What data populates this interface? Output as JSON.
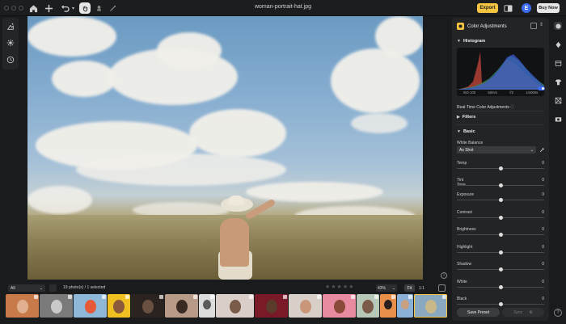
{
  "window": {
    "title": "woman-portrait-hat.jpg"
  },
  "toolbar": {
    "export_label": "Export",
    "avatar_letter": "E",
    "buy_now_label": "Buy Now"
  },
  "panel": {
    "title": "Color Adjustments",
    "histogram": {
      "title": "Histogram",
      "iso": "ISO 100",
      "focal": "50mm",
      "aperture": "f/2",
      "shutter": "1/4000s"
    },
    "realtime_label": "Real-Time Color Adjustments",
    "realtime_on": true,
    "filters_label": "Filters",
    "basic_label": "Basic",
    "white_balance": {
      "label": "White Balance",
      "value": "As Shot"
    },
    "wb_sliders": [
      {
        "label": "Temp",
        "value": "0",
        "level": 0.5
      },
      {
        "label": "Tint",
        "value": "0",
        "level": 0.5
      }
    ],
    "tone_label": "Tone",
    "tone_sliders": [
      {
        "label": "Exposure",
        "value": "0",
        "level": 0.5
      },
      {
        "label": "Contrast",
        "value": "0",
        "level": 0.5
      },
      {
        "label": "Brightness",
        "value": "0",
        "level": 0.5
      },
      {
        "label": "Highlight",
        "value": "0",
        "level": 0.5
      },
      {
        "label": "Shadow",
        "value": "0",
        "level": 0.5
      },
      {
        "label": "White",
        "value": "0",
        "level": 0.5
      },
      {
        "label": "Black",
        "value": "0",
        "level": 0.5
      }
    ],
    "save_preset_label": "Save Preset",
    "sync_label": "Sync"
  },
  "filmstrip": {
    "filter_value": "All",
    "count_text": "19 photo(s) / 1 selected",
    "stars": "★★★★★",
    "zoom_value": "43%",
    "fit_label": "Fit",
    "one_label": "1:1",
    "thumbnails": [
      {
        "name": "group-selfie",
        "bg": "#c97a4a",
        "head": "#e0b090",
        "selected": false,
        "width": 41
      },
      {
        "name": "man-with-cat",
        "bg": "#7a7a7a",
        "head": "#c9c9c9",
        "selected": false,
        "width": 41
      },
      {
        "name": "beach-umbrella",
        "bg": "#8fb8d8",
        "head": "#e65a3a",
        "selected": false,
        "width": 41
      },
      {
        "name": "yellow-portrait",
        "bg": "#f0c020",
        "head": "#8a5a3a",
        "selected": false,
        "width": 28
      },
      {
        "name": "dark-profile",
        "bg": "#2a2320",
        "head": "#6a5040",
        "selected": false,
        "width": 41
      },
      {
        "name": "woman-black-top",
        "bg": "#b89a88",
        "head": "#3a2a24",
        "selected": false,
        "width": 41
      },
      {
        "name": "bw-portrait",
        "bg": "#dcdcdc",
        "head": "#5a5a5a",
        "selected": false,
        "width": 20
      },
      {
        "name": "woman-white",
        "bg": "#d9cfc8",
        "head": "#7a5a48",
        "selected": false,
        "width": 47
      },
      {
        "name": "red-portrait",
        "bg": "#7a1a28",
        "head": "#5a3a2a",
        "selected": false,
        "width": 41
      },
      {
        "name": "smiling-woman",
        "bg": "#d8d0c8",
        "head": "#c9967a",
        "selected": false,
        "width": 41
      },
      {
        "name": "pink-portrait",
        "bg": "#e88aa0",
        "head": "#8a4a3a",
        "selected": false,
        "width": 41
      },
      {
        "name": "couple-outdoor",
        "bg": "#b8c8b8",
        "head": "#7a5a48",
        "selected": false,
        "width": 28
      },
      {
        "name": "orange-sky",
        "bg": "#e8904a",
        "head": "#2a2020",
        "selected": false,
        "width": 20
      },
      {
        "name": "blue-sky",
        "bg": "#8ab0d8",
        "head": "#c9a080",
        "selected": false,
        "width": 20
      },
      {
        "name": "woman-portrait-hat",
        "bg": "#8aa8c0",
        "head": "#c8b88a",
        "selected": true,
        "width": 41
      }
    ]
  },
  "colors": {
    "accent": "#f5c542",
    "toggle": "#3b6cf0"
  }
}
